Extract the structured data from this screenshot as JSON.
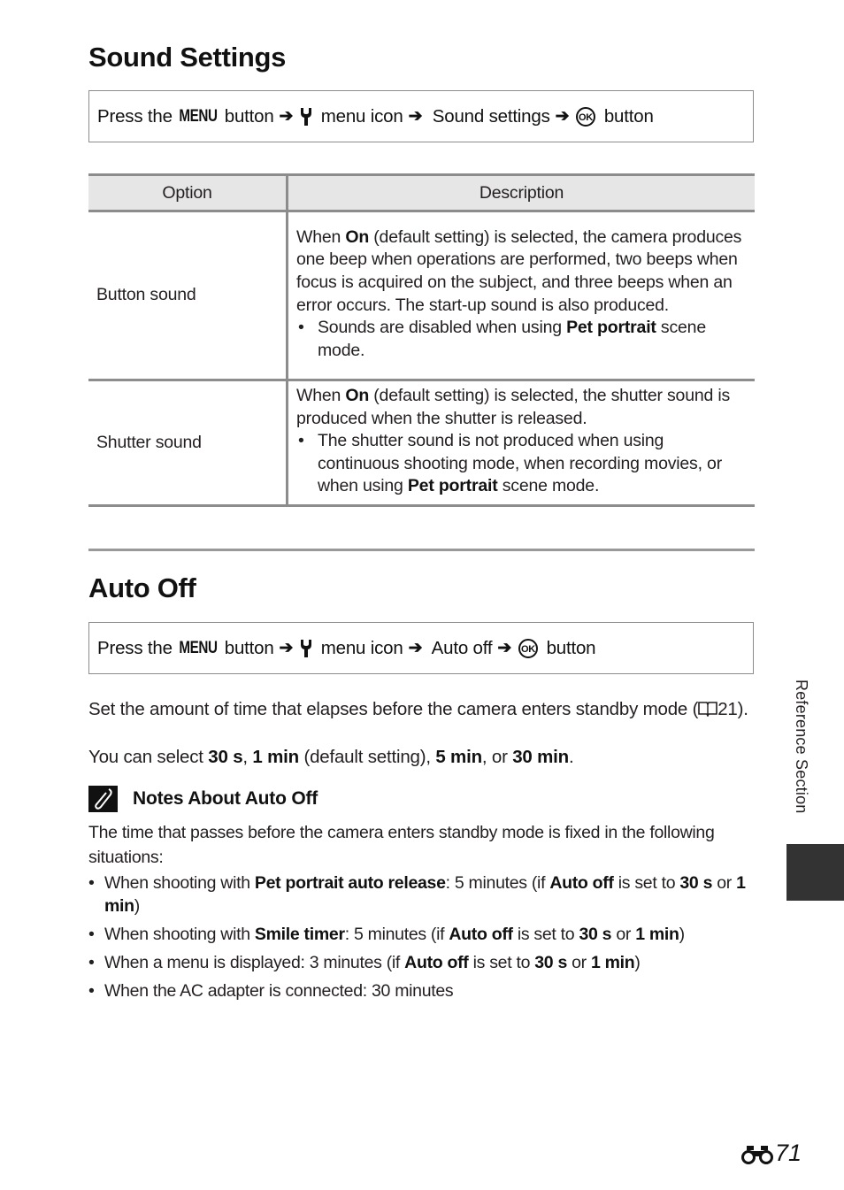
{
  "sound_settings": {
    "title": "Sound Settings",
    "nav": {
      "press_the": "Press the ",
      "menu_button_label": "MENU",
      "button": " button",
      "menu_icon": " menu icon",
      "item": " Sound settings",
      "ok_button": " button",
      "icons": [
        "menu-button-icon",
        "arrow-right-icon",
        "setup-wrench-icon",
        "ok-button-icon"
      ]
    },
    "table": {
      "headers": [
        "Option",
        "Description"
      ],
      "rows": [
        {
          "option": "Button sound",
          "desc_pre": "When ",
          "desc_bold": "On",
          "desc_post": " (default setting) is selected, the camera produces one beep when operations are performed, two beeps when focus is acquired on the subject, and three beeps when an error occurs. The start-up sound is also produced.",
          "bullet_pre": "Sounds are disabled when using ",
          "bullet_bold": "Pet portrait",
          "bullet_post": " scene mode."
        },
        {
          "option": "Shutter sound",
          "desc_pre": "When ",
          "desc_bold": "On",
          "desc_post": " (default setting) is selected, the shutter sound is produced when the shutter is released.",
          "bullet_pre": "The shutter sound is not produced when using continuous shooting mode, when recording movies, or when using ",
          "bullet_bold": "Pet portrait",
          "bullet_post": " scene mode."
        }
      ]
    }
  },
  "auto_off": {
    "title": "Auto Off",
    "nav": {
      "press_the": "Press the ",
      "menu_button_label": "MENU",
      "button": " button",
      "menu_icon": " menu icon",
      "item": " Auto off",
      "ok_button": " button"
    },
    "intro_1": "Set the amount of time that elapses before the camera enters standby mode (",
    "intro_ref": "21",
    "intro_1_end": ").",
    "intro_2": {
      "pre": "You can select ",
      "opt1": "30 s",
      "sep1": ", ",
      "opt2": "1 min",
      "mid": " (default setting), ",
      "opt3": "5 min",
      "sep2": ", or ",
      "opt4": "30 min",
      "end": "."
    },
    "notes": {
      "title": "Notes About Auto Off",
      "lead": "The time that passes before the camera enters standby mode is fixed in the following situations:",
      "items": [
        [
          {
            "t": "When shooting with "
          },
          {
            "b": "Pet portrait auto release"
          },
          {
            "t": ": 5 minutes (if "
          },
          {
            "b": "Auto off"
          },
          {
            "t": " is set to "
          },
          {
            "b": "30 s"
          },
          {
            "t": " or "
          },
          {
            "b": "1 min"
          },
          {
            "t": ")"
          }
        ],
        [
          {
            "t": "When shooting with "
          },
          {
            "b": "Smile timer"
          },
          {
            "t": ": 5 minutes (if "
          },
          {
            "b": "Auto off"
          },
          {
            "t": " is set to "
          },
          {
            "b": "30 s"
          },
          {
            "t": " or "
          },
          {
            "b": "1 min"
          },
          {
            "t": ")"
          }
        ],
        [
          {
            "t": "When a menu is displayed: 3 minutes (if "
          },
          {
            "b": "Auto off"
          },
          {
            "t": " is set to "
          },
          {
            "b": "30 s"
          },
          {
            "t": " or "
          },
          {
            "b": "1 min"
          },
          {
            "t": ")"
          }
        ],
        [
          {
            "t": "When the AC adapter is connected: 30 minutes"
          }
        ]
      ]
    }
  },
  "side_tab": {
    "label": "Reference Section",
    "color": "#333333"
  },
  "footer": {
    "page_number": "71",
    "section_icon": "reference-binoculars-icon"
  },
  "colors": {
    "rule": "#8c8c8c",
    "header_bg": "#e6e6e6",
    "text": "#231f20"
  }
}
